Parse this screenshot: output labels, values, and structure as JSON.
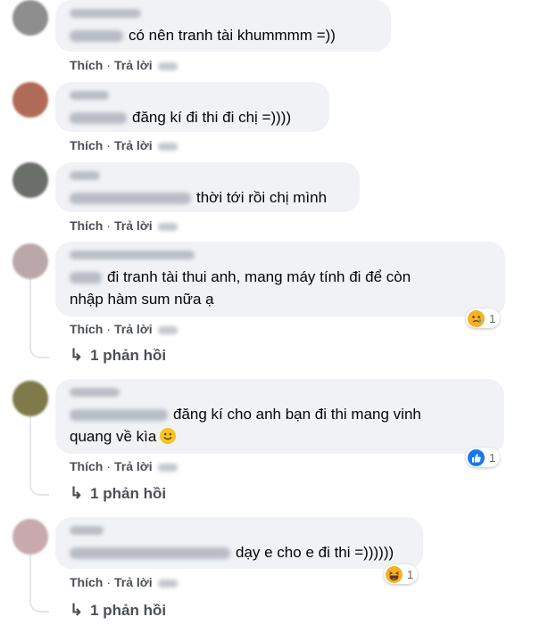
{
  "comments": [
    {
      "text": "có nên tranh tài khummmm =))",
      "like": "Thích",
      "reply": "Trả lời"
    },
    {
      "text": "đăng kí đi thi đi chị =))))",
      "like": "Thích",
      "reply": "Trả lời"
    },
    {
      "text": "thời tới rồi chị mình",
      "like": "Thích",
      "reply": "Trả lời"
    },
    {
      "text_line1": "đi tranh tài thui anh, mang máy tính đi để còn",
      "text_line2": "nhập hàm sum nữa ạ",
      "like": "Thích",
      "reply": "Trả lời",
      "reaction_count": "1",
      "reaction_icon": "sad-reaction-icon",
      "replies": "1 phản hồi"
    },
    {
      "text_line1": "đăng kí cho anh bạn đi thi mang vinh",
      "text_line2": "quang về kìa",
      "like": "Thích",
      "reply": "Trả lời",
      "reaction_count": "1",
      "reaction_icon": "like-reaction-icon",
      "replies": "1 phản hồi"
    },
    {
      "text": "dạy e cho e đi thi =))))))",
      "like": "Thích",
      "reply": "Trả lời",
      "reaction_count": "1",
      "reaction_icon": "haha-reaction-icon",
      "replies": "1 phản hồi"
    }
  ],
  "colors": {
    "bubble": "#f0f2f5",
    "action_text": "#4b4f56",
    "like_blue": "#1877f2"
  }
}
